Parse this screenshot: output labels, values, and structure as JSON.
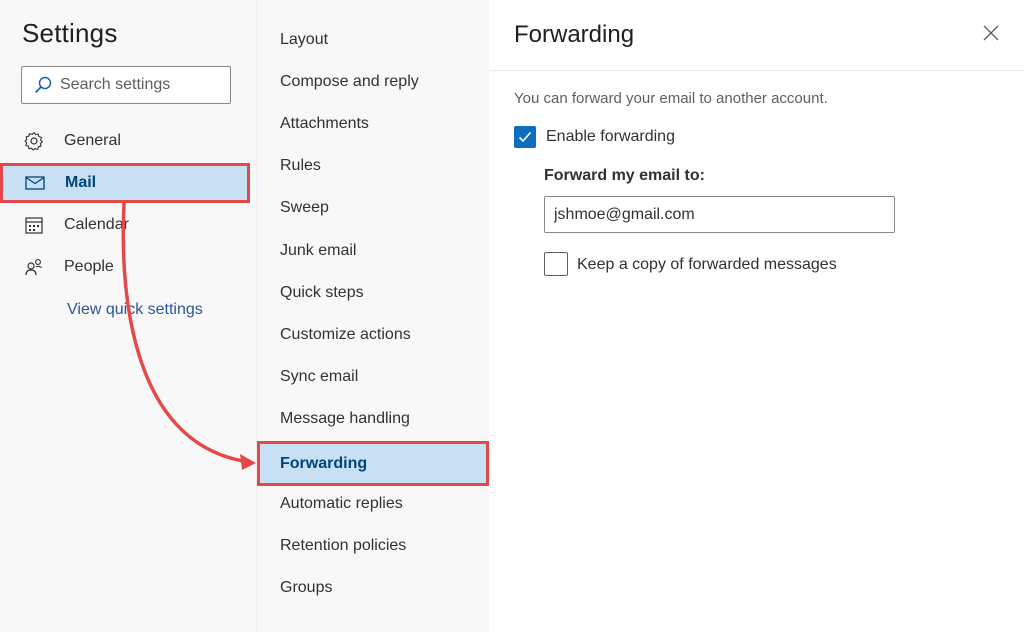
{
  "settings": {
    "title": "Settings",
    "search_placeholder": "Search settings"
  },
  "nav": {
    "items": [
      {
        "label": "General",
        "icon": "gear-icon"
      },
      {
        "label": "Mail",
        "icon": "mail-icon",
        "selected": true
      },
      {
        "label": "Calendar",
        "icon": "calendar-icon"
      },
      {
        "label": "People",
        "icon": "people-icon"
      }
    ],
    "quick_settings": "View quick settings"
  },
  "mail_sections": {
    "items": [
      "Layout",
      "Compose and reply",
      "Attachments",
      "Rules",
      "Sweep",
      "Junk email",
      "Quick steps",
      "Customize actions",
      "Sync email",
      "Message handling",
      "Forwarding",
      "Automatic replies",
      "Retention policies",
      "Groups"
    ],
    "selected": "Forwarding"
  },
  "panel": {
    "title": "Forwarding",
    "description": "You can forward your email to another account.",
    "enable_forwarding": {
      "label": "Enable forwarding",
      "checked": true
    },
    "forward_to_label": "Forward my email to:",
    "forward_to_value": "jshmoe@gmail.com",
    "keep_copy": {
      "label": "Keep a copy of forwarded messages",
      "checked": false
    }
  },
  "colors": {
    "highlight": "#c7e0f4",
    "annotation": "#e44848",
    "accent": "#106ebe"
  }
}
